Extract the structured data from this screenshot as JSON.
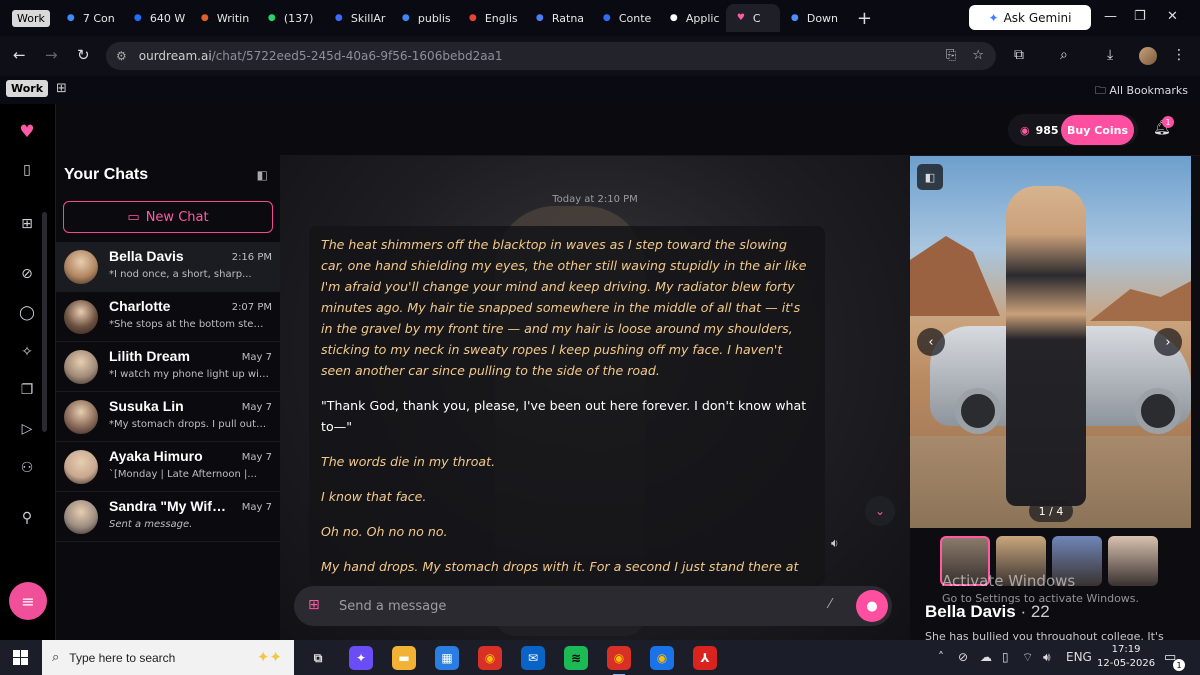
{
  "browser": {
    "work_chip": "Work",
    "tabs": [
      {
        "label": "7 Con",
        "icon": "info-icon",
        "color": "#3c8cff"
      },
      {
        "label": "640 W",
        "icon": "is-icon",
        "color": "#1f6fff"
      },
      {
        "label": "Writin",
        "icon": "sun-icon",
        "color": "#e0602a"
      },
      {
        "label": "(137)",
        "icon": "whatsapp-icon",
        "color": "#25d366"
      },
      {
        "label": "SkillAr",
        "icon": "skillar-icon",
        "color": "#3b6bff"
      },
      {
        "label": "publis",
        "icon": "google-icon",
        "color": "#4285f4"
      },
      {
        "label": "Englis",
        "icon": "gmail-icon",
        "color": "#ea4335"
      },
      {
        "label": "Ratna",
        "icon": "docs-icon",
        "color": "#4a7ff5"
      },
      {
        "label": "Conte",
        "icon": "content-icon",
        "color": "#2f6df6"
      },
      {
        "label": "Applic",
        "icon": "apply-icon",
        "color": "#ffffff"
      },
      {
        "label": "C",
        "icon": "heart-icon",
        "color": "#ff5aa3",
        "active": true
      },
      {
        "label": "Down",
        "icon": "download-icon",
        "color": "#4f8cff"
      }
    ],
    "ask_gemini": "Ask Gemini",
    "url_host": "ourdream.ai",
    "url_path": "/chat/5722eed5-245d-40a6-9f56-1606bebd2aa1",
    "bookmark_work": "Work",
    "all_bookmarks": "All Bookmarks"
  },
  "sidebar": {
    "title": "Your Chats",
    "new_chat": "New Chat",
    "chats": [
      {
        "name": "Bella Davis",
        "time": "2:16 PM",
        "preview": "*I nod once, a short, sharp...",
        "italic": false,
        "active": true,
        "avatar": "#b08560"
      },
      {
        "name": "Charlotte",
        "time": "2:07 PM",
        "preview": "*She stops at the bottom step,...",
        "italic": false,
        "active": false,
        "avatar": "#6c5040"
      },
      {
        "name": "Lilith Dream",
        "time": "May 7",
        "preview": "*I watch my phone light up with...",
        "italic": false,
        "active": false,
        "avatar": "#a08a78"
      },
      {
        "name": "Susuka Lin",
        "time": "May 7",
        "preview": "*My stomach drops. I pull out m...",
        "italic": false,
        "active": false,
        "avatar": "#8a6a58"
      },
      {
        "name": "Ayaka Himuro",
        "time": "May 7",
        "preview": "`[Monday | Late Afternoon |...",
        "italic": false,
        "active": false,
        "avatar": "#c8a890"
      },
      {
        "name": "Sandra \"My Wife, ...",
        "time": "May 7",
        "preview": "Sent a message.",
        "italic": true,
        "active": false,
        "avatar": "#9c8c80"
      }
    ]
  },
  "header": {
    "coins": "985",
    "buy_coins": "Buy Coins",
    "notif_count": "1"
  },
  "chat": {
    "date_label": "Today at 2:10 PM",
    "paragraphs": [
      {
        "kind": "narr",
        "text": "The heat shimmers off the blacktop in waves as I step toward the slowing car, one hand shielding my eyes, the other still waving stupidly in the air like I'm afraid you'll change your mind and keep driving. My radiator blew forty minutes ago. My hair tie snapped somewhere in the middle of all that — it's in the gravel by my front tire — and my hair is loose around my shoulders, sticking to my neck in sweaty ropes I keep pushing off my face. I haven't seen another car since pulling to the side of the road."
      },
      {
        "kind": "speech",
        "text": "\"Thank God, thank you, please, I've been out here forever. I don't know what to—\""
      },
      {
        "kind": "narr",
        "text": "The words die in my throat."
      },
      {
        "kind": "narr",
        "text": "I know that face."
      },
      {
        "kind": "narr",
        "text": "Oh no. Oh no no no."
      },
      {
        "kind": "narr",
        "text": "My hand drops. My stomach drops with it. For a second I just stand there at"
      }
    ],
    "input_placeholder": "Send a message"
  },
  "profile": {
    "counter": "1 / 4",
    "name": "Bella Davis",
    "age": "· 22",
    "bio": "She has bullied you throughout college. It's",
    "thumbs": [
      "#8a7a6a",
      "#c9a77e",
      "#6f86b8",
      "#d9c2b0"
    ],
    "activate_title": "Activate Windows",
    "activate_sub": "Go to Settings to activate Windows."
  },
  "taskbar": {
    "search_placeholder": "Type here to search",
    "apps": [
      {
        "name": "task-view-icon",
        "glyph": "⧉",
        "bg": "transparent",
        "color": "#ddd"
      },
      {
        "name": "copilot-icon",
        "glyph": "✦",
        "bg": "#6b4df5",
        "color": "#fff"
      },
      {
        "name": "file-explorer-icon",
        "glyph": "▬",
        "bg": "#f2b233",
        "color": "#fff"
      },
      {
        "name": "store-icon",
        "glyph": "▦",
        "bg": "#2a7de1",
        "color": "#fff"
      },
      {
        "name": "chrome-icon",
        "glyph": "◉",
        "bg": "#d93025",
        "color": "#fbbc04"
      },
      {
        "name": "outlook-icon",
        "glyph": "✉",
        "bg": "#0a64c8",
        "color": "#fff"
      },
      {
        "name": "spotify-icon",
        "glyph": "≋",
        "bg": "#1db954",
        "color": "#000"
      },
      {
        "name": "chrome-profile-icon",
        "glyph": "◉",
        "bg": "#d93025",
        "color": "#fbbc04",
        "active": true
      },
      {
        "name": "chrome-profile2-icon",
        "glyph": "◉",
        "bg": "#1a73e8",
        "color": "#fbbc04"
      },
      {
        "name": "acrobat-icon",
        "glyph": "⅄",
        "bg": "#d8231e",
        "color": "#fff"
      }
    ],
    "lang": "ENG",
    "time": "17:19",
    "date": "12-05-2026",
    "notif_count": "1"
  }
}
